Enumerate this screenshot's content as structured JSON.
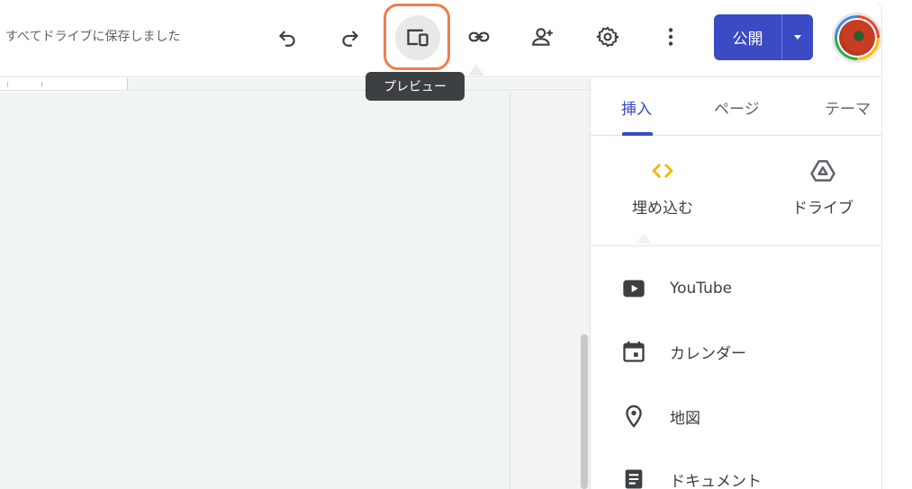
{
  "toolbar": {
    "save_status": "すべてドライブに保存しました",
    "undo_icon": "undo-icon",
    "redo_icon": "redo-icon",
    "preview_icon": "devices-preview-icon",
    "preview_tooltip": "プレビュー",
    "link_icon": "link-icon",
    "share_icon": "person-add-icon",
    "settings_icon": "gear-icon",
    "more_icon": "more-vert-icon",
    "publish_label": "公開",
    "publish_color": "#3b4bc4",
    "highlight_color": "#f07d4e"
  },
  "panel": {
    "tabs": [
      {
        "label": "挿入",
        "active": true
      },
      {
        "label": "ページ",
        "active": false
      },
      {
        "label": "テーマ",
        "active": false
      }
    ],
    "insert_tiles": [
      {
        "label": "埋め込む",
        "icon": "embed-code-icon",
        "color": "#f4b400"
      },
      {
        "label": "ドライブ",
        "icon": "drive-icon",
        "color": "#5f6368"
      }
    ],
    "items": [
      {
        "label": "YouTube",
        "icon": "youtube-icon"
      },
      {
        "label": "カレンダー",
        "icon": "calendar-icon"
      },
      {
        "label": "地図",
        "icon": "map-pin-icon"
      },
      {
        "label": "ドキュメント",
        "icon": "document-icon"
      }
    ]
  },
  "canvas": {
    "background": "#eef5f2"
  }
}
